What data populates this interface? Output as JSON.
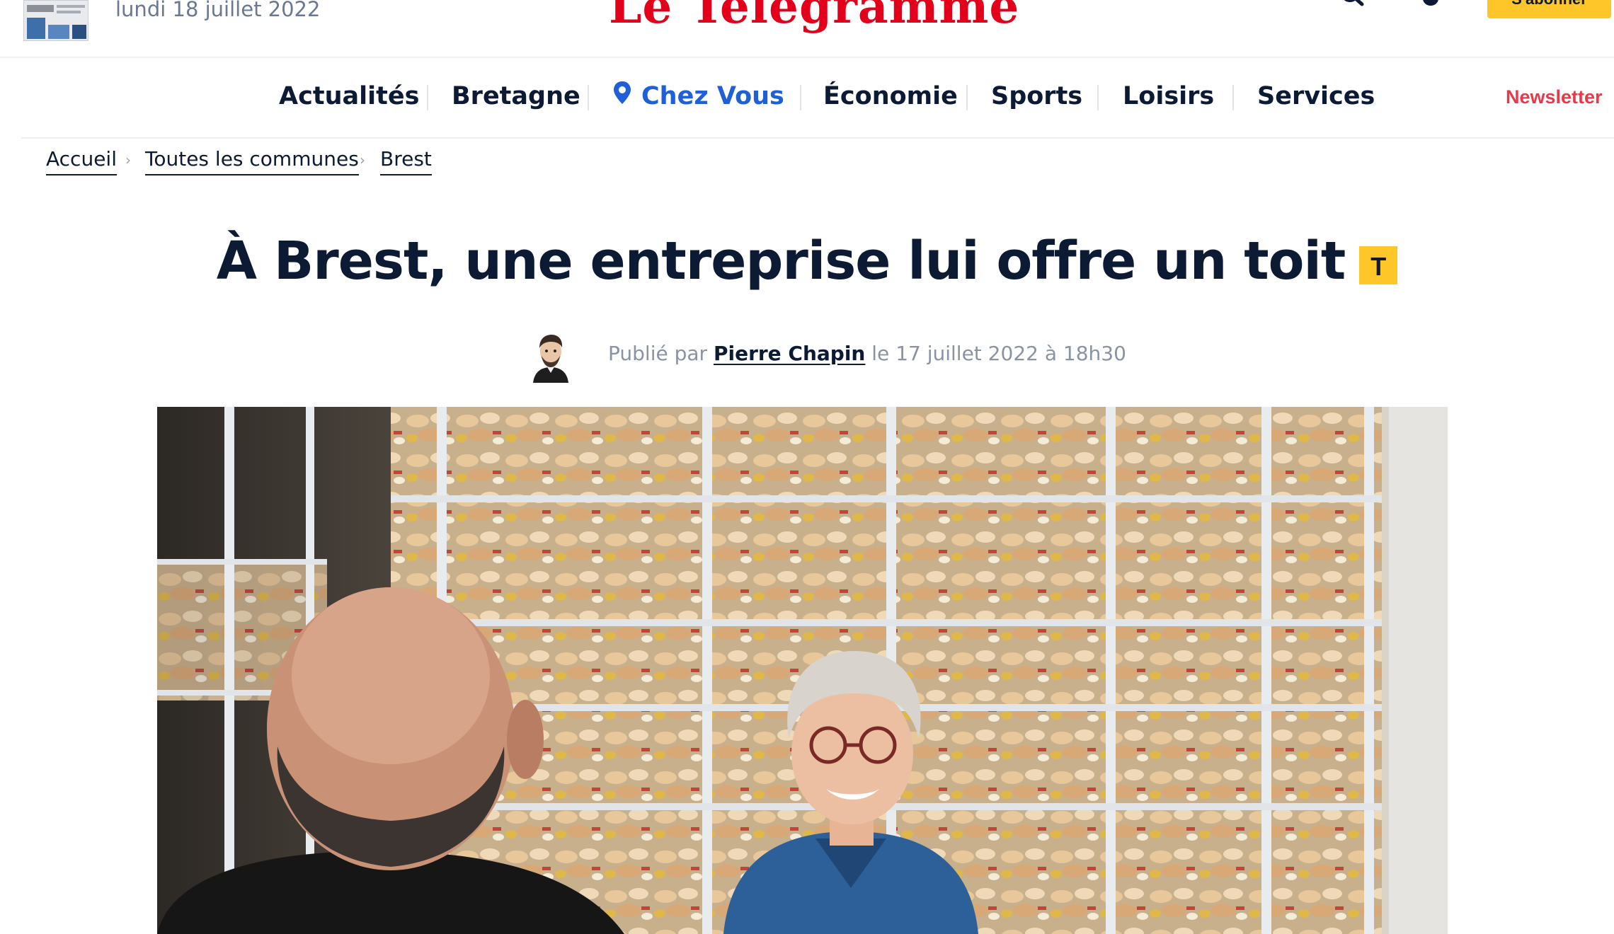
{
  "header": {
    "date": "lundi 18 juillet 2022",
    "logo": "Le Télégramme",
    "subscribe_label": "S'abonner",
    "icons": [
      "search-icon",
      "account-icon",
      "edition-thumbnail"
    ]
  },
  "nav": {
    "items": [
      {
        "label": "Actualités"
      },
      {
        "label": "Bretagne"
      },
      {
        "label": "Chez Vous",
        "icon": "location-pin-icon"
      },
      {
        "label": "Économie"
      },
      {
        "label": "Sports"
      },
      {
        "label": "Loisirs"
      },
      {
        "label": "Services"
      }
    ],
    "newsletter": "Newsletter"
  },
  "breadcrumb": [
    "Accueil",
    "Toutes les communes",
    "Brest"
  ],
  "article": {
    "title": "À Brest, une entreprise lui offre un toit",
    "premium_badge": "T",
    "byline_prefix": "Publié par",
    "author": "Pierre Chapin",
    "byline_suffix": "le 17 juillet 2022 à 18h30"
  },
  "colors": {
    "brand_red": "#e2001a",
    "nav_text": "#0c1a33",
    "chez_vous_blue": "#1f5fd8",
    "newsletter_red": "#e8394a",
    "premium_yellow": "#ffc629",
    "byline_grey": "#8a93a3"
  }
}
